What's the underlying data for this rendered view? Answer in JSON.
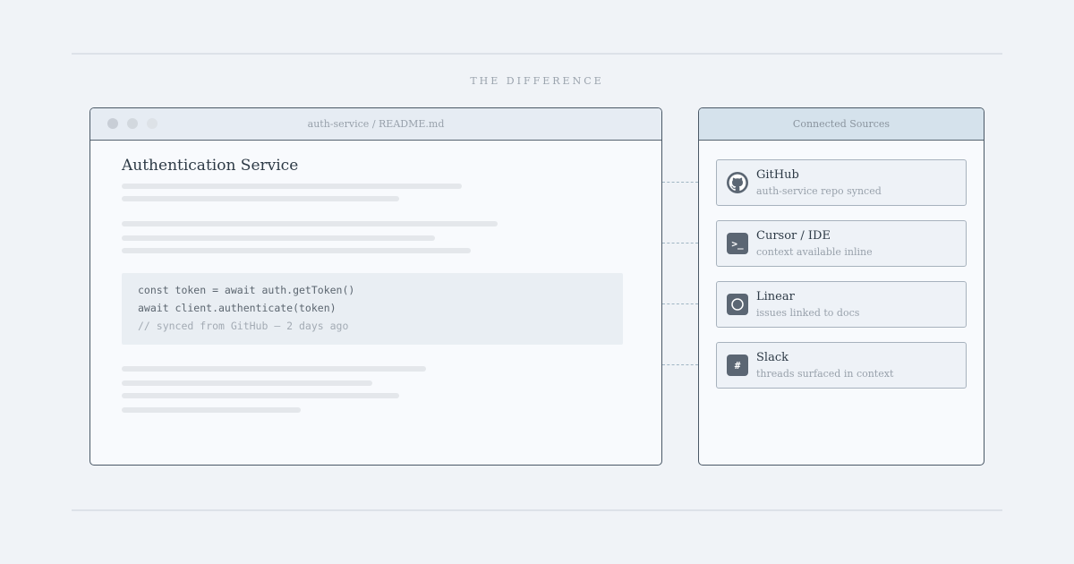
{
  "eyebrow": "THE DIFFERENCE",
  "editor": {
    "window_title": "auth-service / README.md",
    "doc_title": "Authentication Service",
    "code_lines": [
      "const token = await auth.getToken()",
      "await client.authenticate(token)",
      "// synced from GitHub — 2 days ago"
    ]
  },
  "sources": {
    "title": "Connected Sources",
    "items": [
      {
        "name": "GitHub",
        "desc": "auth-service repo synced",
        "icon": "github-icon"
      },
      {
        "name": "Cursor / IDE",
        "desc": "context available inline",
        "icon": "terminal-icon",
        "glyph": ">_"
      },
      {
        "name": "Linear",
        "desc": "issues linked to docs",
        "icon": "circle-icon"
      },
      {
        "name": "Slack",
        "desc": "threads surfaced in context",
        "icon": "hash-icon",
        "glyph": "#"
      }
    ]
  },
  "colors": {
    "background": "#f0f3f7",
    "border": "#4a5866",
    "icon": "#5b6673",
    "accent_header": "#d5e2ec",
    "connector": "#9fb5c3"
  }
}
